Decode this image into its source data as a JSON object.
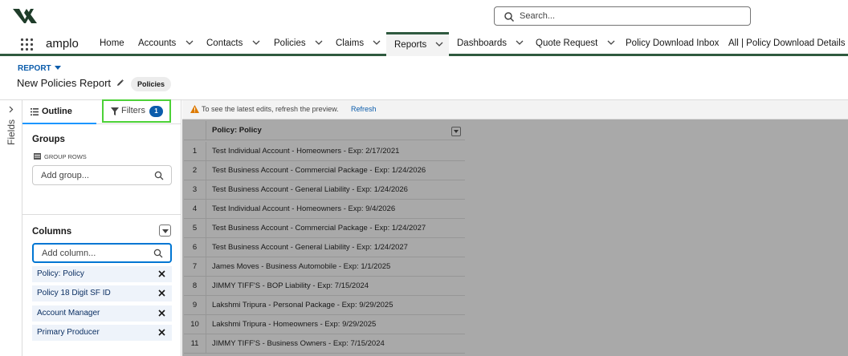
{
  "header": {
    "search_placeholder": "Search...",
    "app_name": "amplo",
    "accent_color": "#2f5a3f"
  },
  "nav": {
    "items": [
      {
        "label": "Home",
        "dropdown": false
      },
      {
        "label": "Accounts",
        "dropdown": true
      },
      {
        "label": "Contacts",
        "dropdown": true
      },
      {
        "label": "Policies",
        "dropdown": true
      },
      {
        "label": "Claims",
        "dropdown": true
      },
      {
        "label": "Reports",
        "dropdown": true,
        "active": true
      },
      {
        "label": "Dashboards",
        "dropdown": true
      },
      {
        "label": "Quote Request",
        "dropdown": true
      },
      {
        "label": "Policy Download Inbox",
        "dropdown": false
      },
      {
        "label": "All | Policy Download Details",
        "dropdown": false
      }
    ]
  },
  "page": {
    "type_label": "REPORT",
    "title": "New Policies Report",
    "report_type": "Policies"
  },
  "rail": {
    "label": "Fields"
  },
  "panel": {
    "tab_outline": "Outline",
    "tab_filters": "Filters",
    "filters_count": "1",
    "groups_title": "Groups",
    "group_rows_label": "GROUP ROWS",
    "add_group_placeholder": "Add group...",
    "columns_title": "Columns",
    "add_column_placeholder": "Add column...",
    "columns": [
      "Policy: Policy",
      "Policy 18 Digit SF ID",
      "Account Manager",
      "Primary Producer"
    ]
  },
  "preview": {
    "notice_text": "To see the latest edits, refresh the preview.",
    "refresh_link": "Refresh",
    "column_header": "Policy: Policy",
    "rows": [
      {
        "n": "1",
        "policy": "Test Individual Account - Homeowners - Exp: 2/17/2021"
      },
      {
        "n": "2",
        "policy": "Test Business Account - Commercial Package - Exp: 1/24/2026"
      },
      {
        "n": "3",
        "policy": "Test Business Account - General Liability - Exp: 1/24/2026"
      },
      {
        "n": "4",
        "policy": "Test Individual Account - Homeowners - Exp: 9/4/2026"
      },
      {
        "n": "5",
        "policy": "Test Business Account - Commercial Package - Exp: 1/24/2027"
      },
      {
        "n": "6",
        "policy": "Test Business Account - General Liability - Exp: 1/24/2027"
      },
      {
        "n": "7",
        "policy": "James Moves - Business Automobile - Exp: 1/1/2025"
      },
      {
        "n": "8",
        "policy": "JIMMY TIFF'S - BOP Liability - Exp: 7/15/2024"
      },
      {
        "n": "9",
        "policy": "Lakshmi Tripura - Personal Package - Exp: 9/29/2025"
      },
      {
        "n": "10",
        "policy": "Lakshmi Tripura - Homeowners - Exp: 9/29/2025"
      },
      {
        "n": "11",
        "policy": "JIMMY TIFF'S - Business Owners - Exp: 7/15/2024"
      }
    ]
  }
}
